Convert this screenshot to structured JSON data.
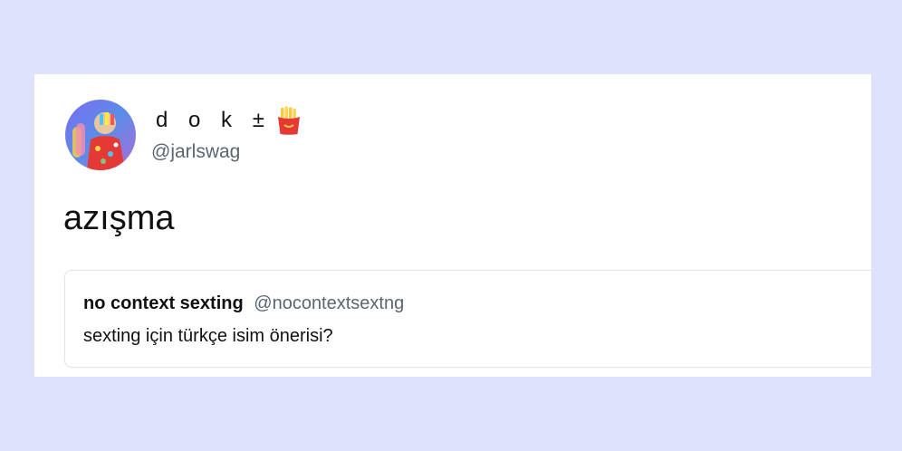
{
  "tweet": {
    "author": {
      "display_name": "d o k ±",
      "display_name_emoji": "fries-icon",
      "handle": "@jarlswag",
      "avatar": "avatar-image"
    },
    "text": "azışma"
  },
  "quoted_tweet": {
    "author_name": "no context sexting",
    "author_handle": "@nocontextsextng",
    "text": "sexting için türkçe isim önerisi?"
  },
  "colors": {
    "page_background": "#dfe2fd",
    "card_background": "#ffffff",
    "secondary_text": "#5b6670",
    "primary_text": "#111111",
    "quote_border": "#dfe3e7"
  }
}
